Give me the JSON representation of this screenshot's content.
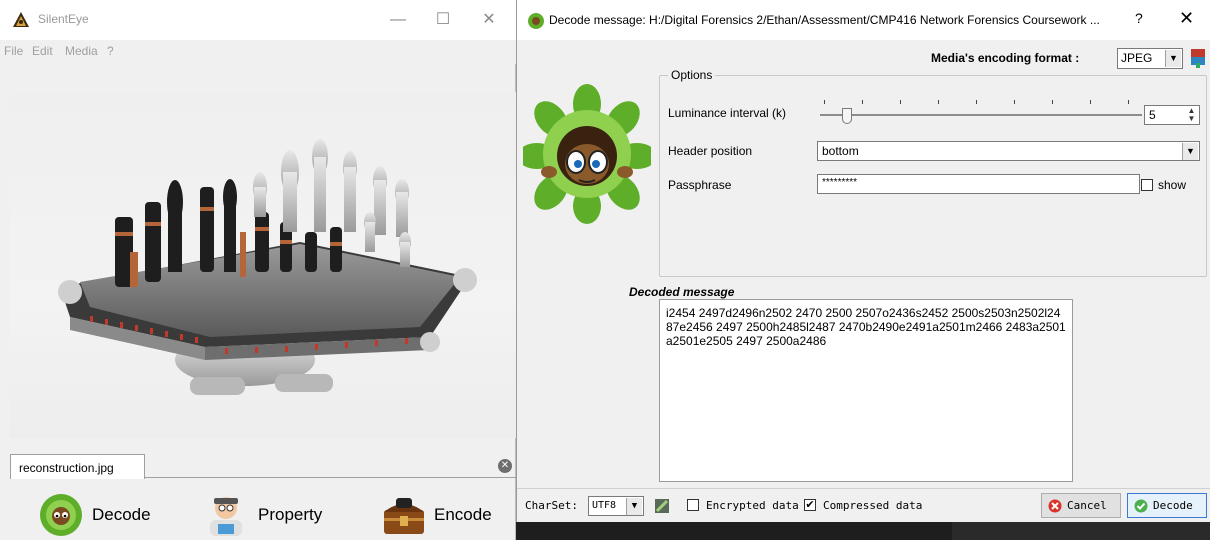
{
  "main_window": {
    "title": "SilentEye",
    "controls": {
      "minimize": "—",
      "maximize": "☐",
      "close": "✕"
    },
    "menu": [
      "File",
      "Edit",
      "Media",
      "?"
    ],
    "file_tab": "reconstruction.jpg",
    "actions": {
      "decode": "Decode",
      "property": "Property",
      "encode": "Encode"
    }
  },
  "dialog": {
    "title": "Decode message: H:/Digital Forensics 2/Ethan/Assessment/CMP416 Network Forensics Coursework ...",
    "help": "?",
    "close": "✕",
    "format_label": "Media's encoding format :",
    "format_value": "JPEG",
    "options_title": "Options",
    "luminance_label": "Luminance interval (k)",
    "luminance_value": "5",
    "header_label": "Header position",
    "header_value": "bottom",
    "passphrase_label": "Passphrase",
    "passphrase_value": "*********",
    "show_label": "show",
    "decoded_title": "Decoded message",
    "decoded_text": "i2454 2497d2496n2502 2470 2500 2507o2436s2452 2500s2503n2502l2487e2456 2497 2500h2485l2487 2470b2490e2491a2501m2466 2483a2501a2501e2505 2497 2500a2486",
    "charset_label": "CharSet:",
    "charset_value": "UTF8",
    "encrypted_label": "Encrypted data",
    "compressed_label": "Compressed data",
    "compressed_checked": "✔",
    "cancel_label": "Cancel",
    "decode_label": "Decode"
  }
}
